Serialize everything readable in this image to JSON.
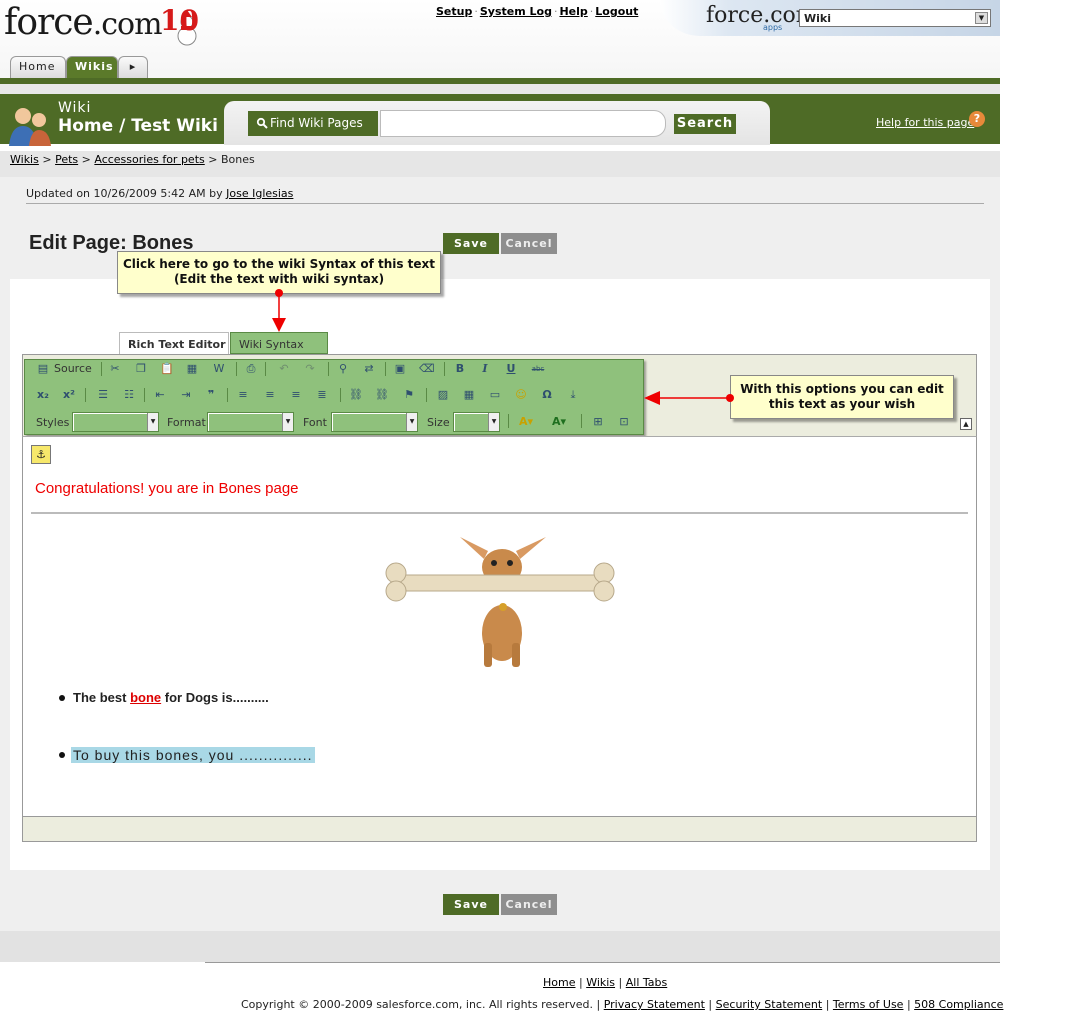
{
  "header": {
    "logo_text": "force",
    "logo_suffix": ".com",
    "logo_anniversary": "10",
    "top_links": [
      "Setup",
      "System Log",
      "Help",
      "Logout"
    ],
    "app_logo": "force.com",
    "app_logo_sub": "apps",
    "app_selector_value": "Wiki",
    "tabs": [
      "Home",
      "Wikis"
    ]
  },
  "wikibar": {
    "label": "Wiki",
    "title": "Home / Test Wiki",
    "find_label": "Find Wiki Pages",
    "search_value": "",
    "search_button": "Search",
    "help_link": "Help for this page",
    "help_icon": "?"
  },
  "breadcrumb": {
    "items": [
      "Wikis",
      "Pets",
      "Accessories for pets"
    ],
    "current": "Bones"
  },
  "page": {
    "updated_prefix": "Updated on 10/26/2009 5:42 AM by",
    "updated_author": "Jose Iglesias",
    "title": "Edit Page: Bones",
    "save_label": "Save",
    "cancel_label": "Cancel"
  },
  "editor": {
    "tabs": [
      "Rich Text Editor",
      "Wiki Syntax"
    ],
    "toolbar": {
      "source_label": "Source",
      "styles_label": "Styles",
      "format_label": "Format",
      "font_label": "Font",
      "size_label": "Size"
    },
    "content": {
      "heading": "Congratulations! you are in Bones page",
      "li1_prefix": "The best ",
      "li1_link": "bone",
      "li1_suffix": " for Dogs is..........",
      "li2": "To buy this bones, you ..............."
    }
  },
  "callouts": {
    "wiki_syntax": "Click here to go to the wiki Syntax of this text\n(Edit the text with wiki syntax)",
    "toolbar": "With this options you can edit\nthis text as your wish"
  },
  "footer": {
    "links": [
      "Home",
      "Wikis",
      "All Tabs"
    ],
    "copyright": "Copyright © 2000-2009 salesforce.com, inc. All rights reserved. |",
    "legal_links": [
      "Privacy Statement",
      "Security Statement",
      "Terms of Use",
      "508 Compliance"
    ]
  },
  "colors": {
    "brand_green": "#4e6b26",
    "toolbar_green": "#8fc17c",
    "callout_yellow": "#ffffcc",
    "heading_red": "#e00000",
    "highlight_blue": "#a9d8e6"
  }
}
